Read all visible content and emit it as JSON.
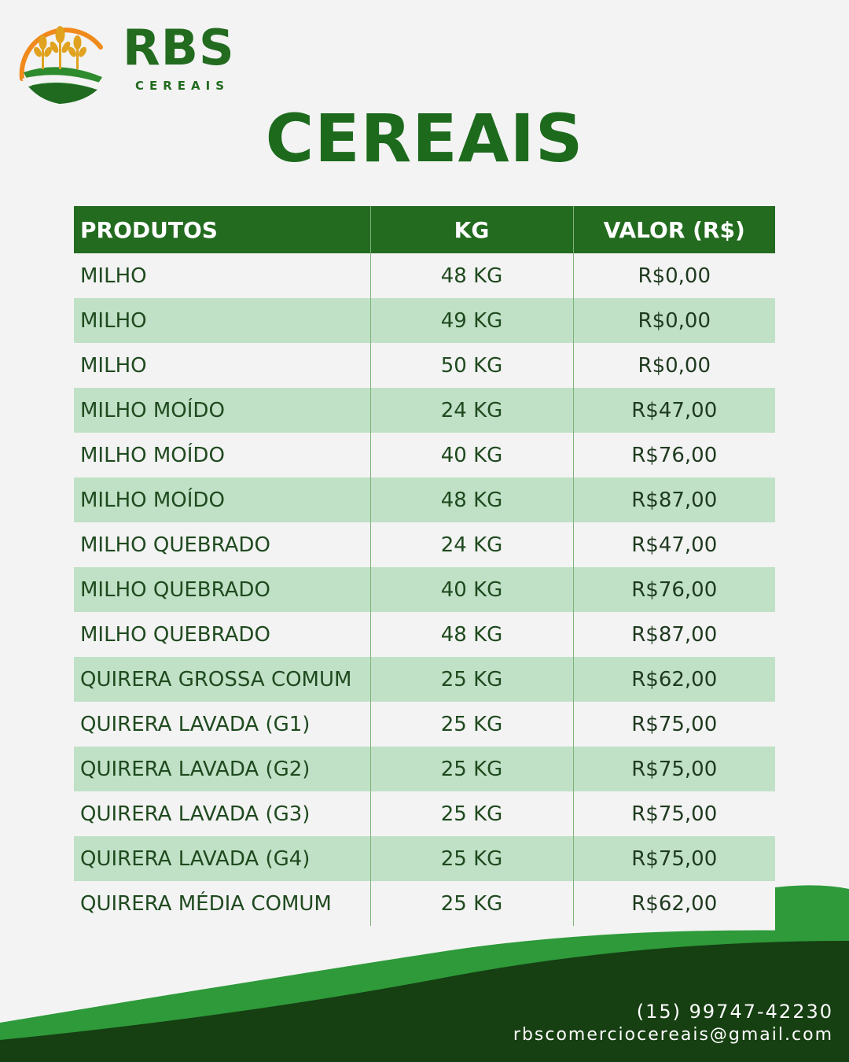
{
  "brand": {
    "name": "RBS",
    "subtitle": "CEREAIS",
    "colors": {
      "green_dark": "#226b1f",
      "green_light": "#2e9a3a",
      "orange": "#f08a1c",
      "gold": "#e0a21f"
    }
  },
  "page": {
    "title": "CEREAIS"
  },
  "table": {
    "headers": [
      "PRODUTOS",
      "KG",
      "VALOR (R$)"
    ],
    "rows": [
      [
        "MILHO",
        "48 KG",
        "R$0,00"
      ],
      [
        "MILHO",
        "49 KG",
        "R$0,00"
      ],
      [
        "MILHO",
        "50 KG",
        "R$0,00"
      ],
      [
        "MILHO MOÍDO",
        "24 KG",
        "R$47,00"
      ],
      [
        "MILHO MOÍDO",
        "40 KG",
        "R$76,00"
      ],
      [
        "MILHO MOÍDO",
        "48 KG",
        "R$87,00"
      ],
      [
        "MILHO QUEBRADO",
        "24 KG",
        "R$47,00"
      ],
      [
        "MILHO QUEBRADO",
        "40 KG",
        "R$76,00"
      ],
      [
        "MILHO QUEBRADO",
        "48 KG",
        "R$87,00"
      ],
      [
        "QUIRERA GROSSA COMUM",
        "25 KG",
        "R$62,00"
      ],
      [
        "QUIRERA LAVADA (G1)",
        "25 KG",
        "R$75,00"
      ],
      [
        "QUIRERA LAVADA (G2)",
        "25 KG",
        "R$75,00"
      ],
      [
        "QUIRERA LAVADA (G3)",
        "25 KG",
        "R$75,00"
      ],
      [
        "QUIRERA LAVADA (G4)",
        "25 KG",
        "R$75,00"
      ],
      [
        "QUIRERA MÉDIA COMUM",
        "25 KG",
        "R$62,00"
      ]
    ]
  },
  "contact": {
    "phone": "(15) 99747-42230",
    "email": "rbscomerciocereais@gmail.com"
  }
}
